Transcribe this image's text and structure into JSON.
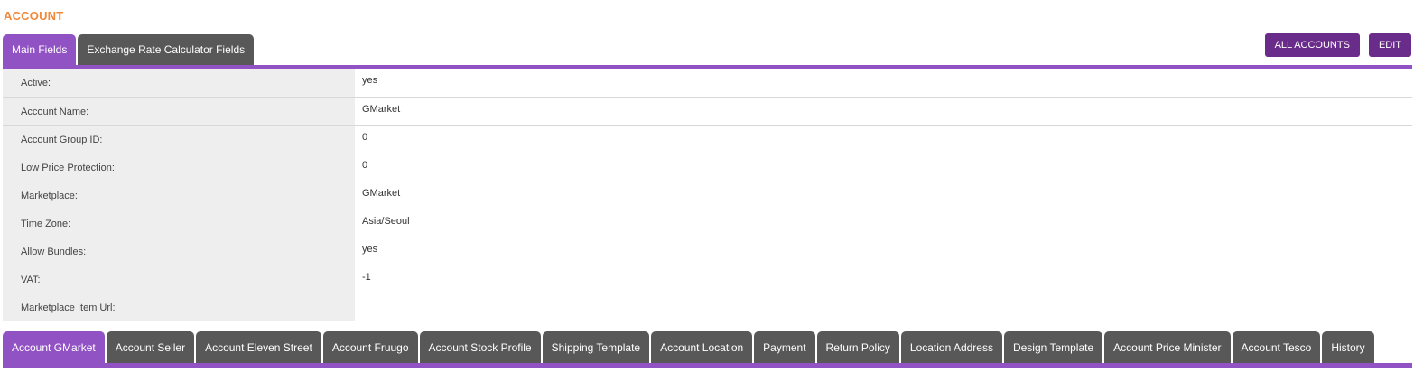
{
  "page_title": "ACCOUNT",
  "top_tabs": [
    {
      "label": "Main Fields",
      "active": true
    },
    {
      "label": "Exchange Rate Calculator Fields",
      "active": false
    }
  ],
  "actions": {
    "all_accounts_label": "ALL ACCOUNTS",
    "edit_label": "EDIT"
  },
  "fields": [
    {
      "label": "Active:",
      "value": "yes"
    },
    {
      "label": "Account Name:",
      "value": "GMarket"
    },
    {
      "label": "Account Group ID:",
      "value": "0"
    },
    {
      "label": "Low Price Protection:",
      "value": "0"
    },
    {
      "label": "Marketplace:",
      "value": "GMarket"
    },
    {
      "label": "Time Zone:",
      "value": "Asia/Seoul"
    },
    {
      "label": "Allow Bundles:",
      "value": "yes"
    },
    {
      "label": "VAT:",
      "value": "-1"
    },
    {
      "label": "Marketplace Item Url:",
      "value": ""
    }
  ],
  "bottom_tabs": [
    {
      "label": "Account GMarket",
      "active": true
    },
    {
      "label": "Account Seller",
      "active": false
    },
    {
      "label": "Account Eleven Street",
      "active": false
    },
    {
      "label": "Account Fruugo",
      "active": false
    },
    {
      "label": "Account Stock Profile",
      "active": false
    },
    {
      "label": "Shipping Template",
      "active": false
    },
    {
      "label": "Account Location",
      "active": false
    },
    {
      "label": "Payment",
      "active": false
    },
    {
      "label": "Return Policy",
      "active": false
    },
    {
      "label": "Location Address",
      "active": false
    },
    {
      "label": "Design Template",
      "active": false
    },
    {
      "label": "Account Price Minister",
      "active": false
    },
    {
      "label": "Account Tesco",
      "active": false
    },
    {
      "label": "History",
      "active": false
    }
  ],
  "colors": {
    "accent": "#9152c4",
    "button": "#6a2c8a",
    "title": "#f0893a",
    "inactive_tab": "#585858"
  }
}
